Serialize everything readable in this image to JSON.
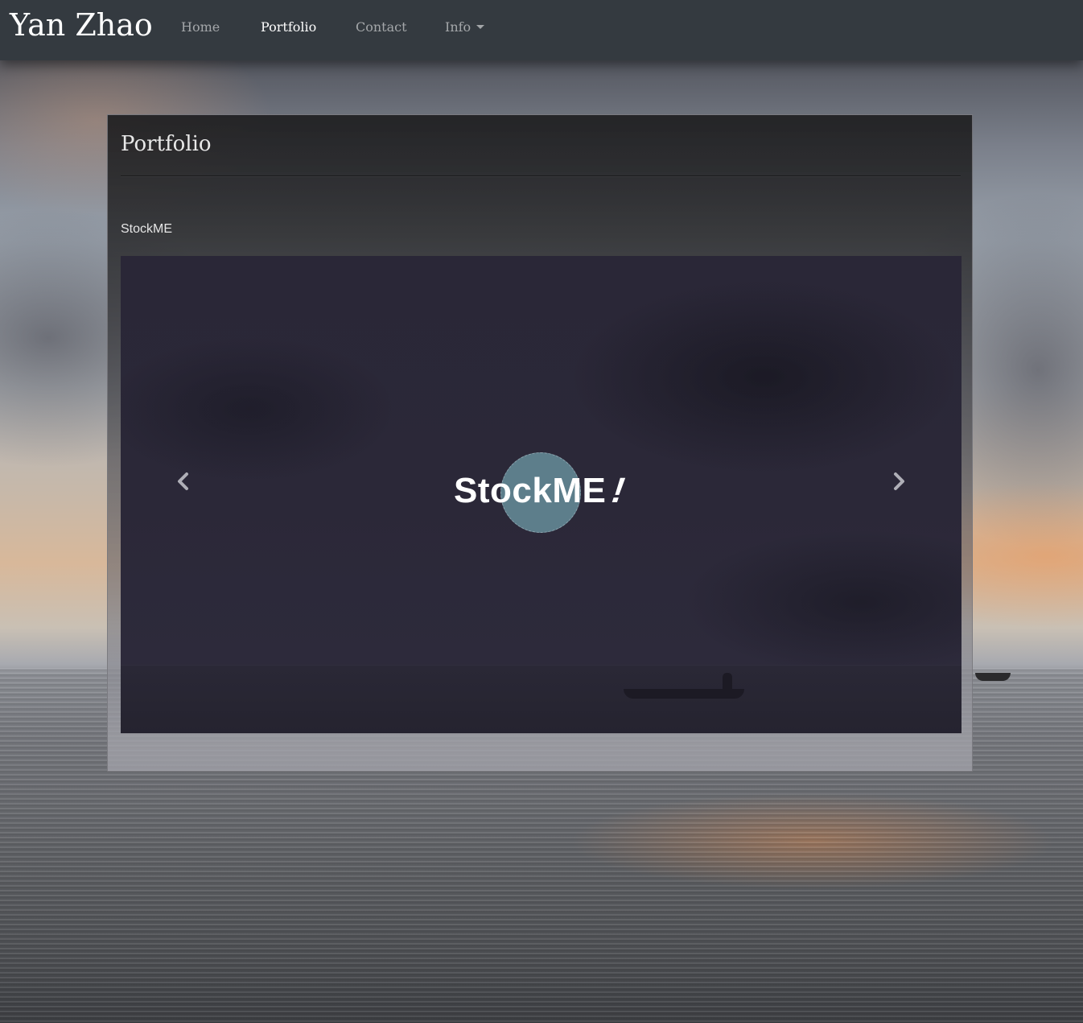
{
  "navbar": {
    "brand": "Yan Zhao",
    "links": [
      {
        "label": "Home",
        "active": false
      },
      {
        "label": "Portfolio",
        "active": true
      },
      {
        "label": "Contact",
        "active": false
      },
      {
        "label": "Info",
        "active": false,
        "dropdown": true
      }
    ]
  },
  "panel": {
    "title": "Portfolio",
    "project_name": "StockME"
  },
  "carousel": {
    "logo_text": "StockME",
    "logo_exclamation": "!",
    "prev_icon": "chevron-left-icon",
    "next_icon": "chevron-right-icon",
    "logo_circle_color": "#5d7e8b"
  },
  "colors": {
    "navbar_bg": "#343a40",
    "nav_active": "#ffffff",
    "nav_inactive": "rgba(255,255,255,0.55)"
  }
}
